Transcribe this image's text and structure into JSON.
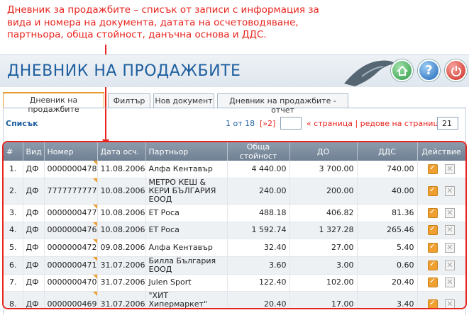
{
  "annotation": "Дневник за продажбите – списък от записи с информация за вида и номера на документа, датата на осчетоводяване, партньора, обща стойност, данъчна основа и ДДС.",
  "header": {
    "title": "ДНЕВНИК НА ПРОДАЖБИТЕ"
  },
  "tabs": [
    {
      "label": "Дневник на продажбите"
    },
    {
      "label": "Филтър"
    },
    {
      "label": "Нов документ"
    },
    {
      "label": "Дневник на продажбите - отчет"
    }
  ],
  "list": {
    "label": "Списък"
  },
  "pager": {
    "position": "1 от 18",
    "next": "[»2]",
    "text": "« страница | редове на страница »",
    "rows_per_page": "21"
  },
  "table": {
    "columns": [
      "#",
      "Вид",
      "Номер",
      "Дата осч.",
      "Партньор",
      "Обща стойност",
      "ДО",
      "ДДС",
      "Действие"
    ],
    "rows": [
      {
        "n": "1.",
        "type": "ДФ",
        "number": "0000000478",
        "date": "11.08.2006",
        "partner": "Алфа Кентавър",
        "total": "4 440.00",
        "base": "3 700.00",
        "vat": "740.00"
      },
      {
        "n": "2.",
        "type": "ДФ",
        "number": "7777777777",
        "date": "10.08.2006",
        "partner": "МЕТРО КЕШ & КЕРИ БЪЛГАРИЯ ЕООД",
        "total": "240.00",
        "base": "200.00",
        "vat": "40.00"
      },
      {
        "n": "3.",
        "type": "ДФ",
        "number": "0000000477",
        "date": "10.08.2006",
        "partner": "ЕТ Роса",
        "total": "488.18",
        "base": "406.82",
        "vat": "81.36"
      },
      {
        "n": "4.",
        "type": "ДФ",
        "number": "0000000476",
        "date": "10.08.2006",
        "partner": "ЕТ Роса",
        "total": "1 592.74",
        "base": "1 327.28",
        "vat": "265.46"
      },
      {
        "n": "5.",
        "type": "ДФ",
        "number": "0000000472",
        "date": "09.08.2006",
        "partner": "Алфа Кентавър",
        "total": "32.40",
        "base": "27.00",
        "vat": "5.40"
      },
      {
        "n": "6.",
        "type": "ДФ",
        "number": "0000000471",
        "date": "31.07.2006",
        "partner": "Билла България ЕООД",
        "total": "3.60",
        "base": "3.00",
        "vat": "0.60"
      },
      {
        "n": "7.",
        "type": "ДФ",
        "number": "0000000470",
        "date": "31.07.2006",
        "partner": "Julen Sport",
        "total": "122.40",
        "base": "102.00",
        "vat": "20.40"
      },
      {
        "n": "8.",
        "type": "ДФ",
        "number": "0000000469",
        "date": "31.07.2006",
        "partner": "\"ХИТ Хипермаркет\" ЕООД",
        "total": "20.40",
        "base": "17.00",
        "vat": "3.40"
      }
    ]
  },
  "icons": {
    "home": "home-icon",
    "help": "help-icon",
    "power": "power-icon",
    "edit": "edit-icon",
    "delete": "delete-icon"
  },
  "colors": {
    "accent_blue": "#1e5f9f",
    "annotation_red": "#e8241f",
    "edit_orange": "#f0a030",
    "header_gray": "#7b8a9a"
  }
}
